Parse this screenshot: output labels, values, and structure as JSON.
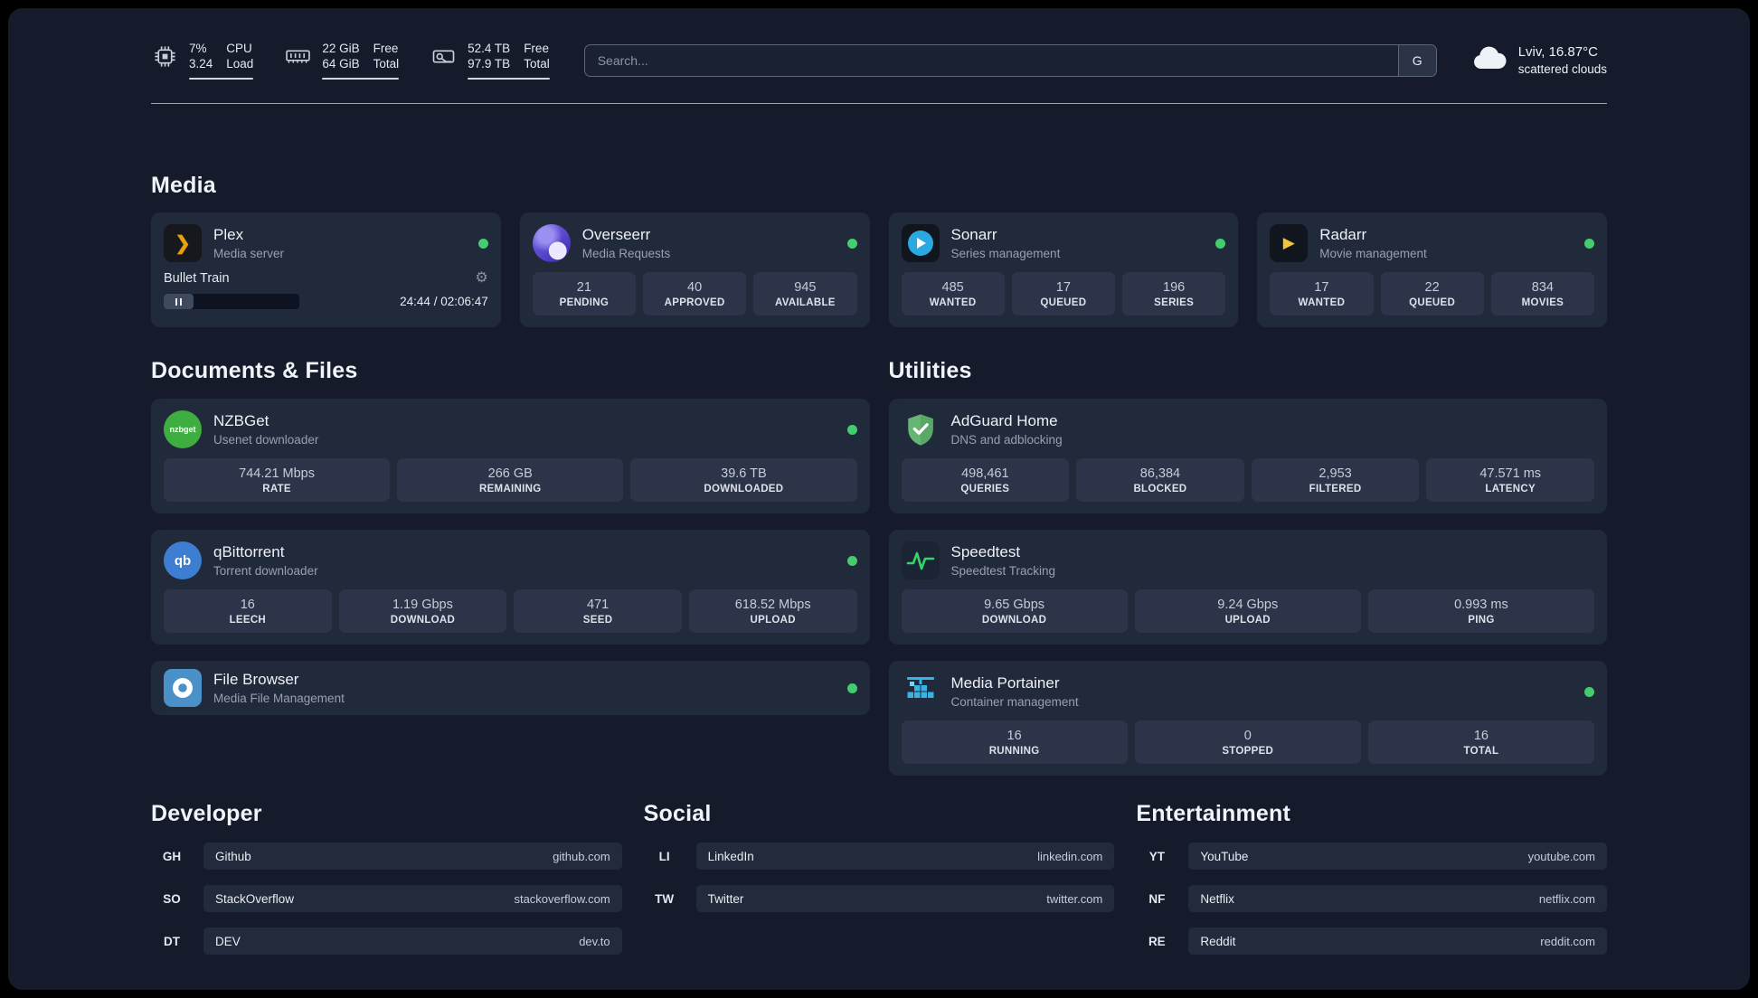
{
  "colors": {
    "background": "#151b2b",
    "card": "#212a3b",
    "tile": "#2b3448",
    "status_online": "#43cd6e"
  },
  "topbar": {
    "metrics": [
      {
        "icon": "cpu-chip-icon",
        "values": [
          "7%",
          "3.24"
        ],
        "labels": [
          "CPU",
          "Load"
        ]
      },
      {
        "icon": "memory-icon",
        "values": [
          "22 GiB",
          "64 GiB"
        ],
        "labels": [
          "Free",
          "Total"
        ]
      },
      {
        "icon": "hard-disk-icon",
        "values": [
          "52.4 TB",
          "97.9 TB"
        ],
        "labels": [
          "Free",
          "Total"
        ]
      }
    ],
    "search": {
      "placeholder": "Search...",
      "engine_button": "G"
    },
    "weather": {
      "icon": "cloud-icon",
      "location_temp": "Lviv, 16.87°C",
      "condition": "scattered clouds"
    }
  },
  "media": {
    "title": "Media",
    "plex": {
      "icon": "plex-icon",
      "name": "Plex",
      "subtitle": "Media server",
      "status": "online",
      "now_playing": "Bullet Train",
      "time": "24:44 / 02:06:47",
      "progress_percent": 19.5
    },
    "overseerr": {
      "icon": "overseerr-icon",
      "name": "Overseerr",
      "subtitle": "Media Requests",
      "status": "online",
      "stats": [
        {
          "value": "21",
          "label": "PENDING"
        },
        {
          "value": "40",
          "label": "APPROVED"
        },
        {
          "value": "945",
          "label": "AVAILABLE"
        }
      ]
    },
    "sonarr": {
      "icon": "sonarr-icon",
      "name": "Sonarr",
      "subtitle": "Series management",
      "status": "online",
      "stats": [
        {
          "value": "485",
          "label": "WANTED"
        },
        {
          "value": "17",
          "label": "QUEUED"
        },
        {
          "value": "196",
          "label": "SERIES"
        }
      ]
    },
    "radarr": {
      "icon": "radarr-icon",
      "name": "Radarr",
      "subtitle": "Movie management",
      "status": "online",
      "stats": [
        {
          "value": "17",
          "label": "WANTED"
        },
        {
          "value": "22",
          "label": "QUEUED"
        },
        {
          "value": "834",
          "label": "MOVIES"
        }
      ]
    }
  },
  "documents": {
    "title": "Documents & Files",
    "nzbget": {
      "icon": "nzbget-icon",
      "icon_text": "nzbget",
      "name": "NZBGet",
      "subtitle": "Usenet downloader",
      "status": "online",
      "stats": [
        {
          "value": "744.21 Mbps",
          "label": "RATE"
        },
        {
          "value": "266 GB",
          "label": "REMAINING"
        },
        {
          "value": "39.6 TB",
          "label": "DOWNLOADED"
        }
      ]
    },
    "qbittorrent": {
      "icon": "qbittorrent-icon",
      "icon_text": "qb",
      "name": "qBittorrent",
      "subtitle": "Torrent downloader",
      "status": "online",
      "stats": [
        {
          "value": "16",
          "label": "LEECH"
        },
        {
          "value": "1.19 Gbps",
          "label": "DOWNLOAD"
        },
        {
          "value": "471",
          "label": "SEED"
        },
        {
          "value": "618.52 Mbps",
          "label": "UPLOAD"
        }
      ]
    },
    "filebrowser": {
      "icon": "filebrowser-icon",
      "name": "File Browser",
      "subtitle": "Media File Management",
      "status": "online"
    }
  },
  "utilities": {
    "title": "Utilities",
    "adguard": {
      "icon": "adguard-icon",
      "name": "AdGuard Home",
      "subtitle": "DNS and adblocking",
      "stats": [
        {
          "value": "498,461",
          "label": "QUERIES"
        },
        {
          "value": "86,384",
          "label": "BLOCKED"
        },
        {
          "value": "2,953",
          "label": "FILTERED"
        },
        {
          "value": "47.571 ms",
          "label": "LATENCY"
        }
      ]
    },
    "speedtest": {
      "icon": "speedtest-icon",
      "name": "Speedtest",
      "subtitle": "Speedtest Tracking",
      "stats": [
        {
          "value": "9.65 Gbps",
          "label": "DOWNLOAD"
        },
        {
          "value": "9.24 Gbps",
          "label": "UPLOAD"
        },
        {
          "value": "0.993 ms",
          "label": "PING"
        }
      ]
    },
    "portainer": {
      "icon": "portainer-icon",
      "name": "Media Portainer",
      "subtitle": "Container management",
      "status": "online",
      "stats": [
        {
          "value": "16",
          "label": "RUNNING"
        },
        {
          "value": "0",
          "label": "STOPPED"
        },
        {
          "value": "16",
          "label": "TOTAL"
        }
      ]
    }
  },
  "bookmarks": {
    "developer": {
      "title": "Developer",
      "items": [
        {
          "abbr": "GH",
          "name": "Github",
          "url": "github.com"
        },
        {
          "abbr": "SO",
          "name": "StackOverflow",
          "url": "stackoverflow.com"
        },
        {
          "abbr": "DT",
          "name": "DEV",
          "url": "dev.to"
        }
      ]
    },
    "social": {
      "title": "Social",
      "items": [
        {
          "abbr": "LI",
          "name": "LinkedIn",
          "url": "linkedin.com"
        },
        {
          "abbr": "TW",
          "name": "Twitter",
          "url": "twitter.com"
        }
      ]
    },
    "entertainment": {
      "title": "Entertainment",
      "items": [
        {
          "abbr": "YT",
          "name": "YouTube",
          "url": "youtube.com"
        },
        {
          "abbr": "NF",
          "name": "Netflix",
          "url": "netflix.com"
        },
        {
          "abbr": "RE",
          "name": "Reddit",
          "url": "reddit.com"
        }
      ]
    }
  }
}
